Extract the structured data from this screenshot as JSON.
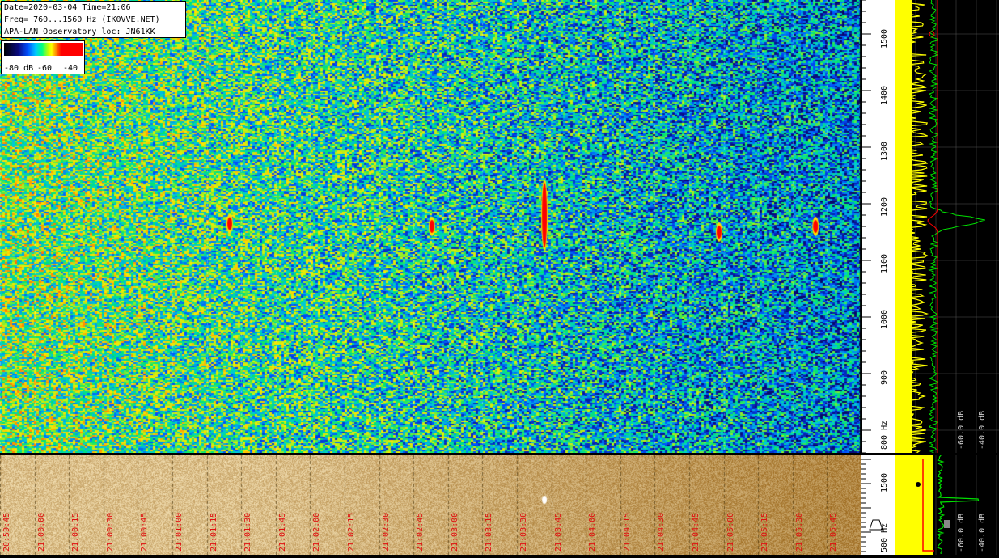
{
  "header": {
    "line1": "Date=2020-03-04 Time=21:06",
    "line2": "Freq= 760...1560 Hz (IK0VVE.NET)",
    "line3": "APA-LAN Observatory loc: JN61KK"
  },
  "colorbar": {
    "labels": [
      "-80 dB",
      "-60",
      "-40"
    ],
    "colors": [
      "#000000",
      "#0a0a80",
      "#0050ff",
      "#00c8ff",
      "#00ff80",
      "#ffff00",
      "#ff0000"
    ]
  },
  "freq_axis": {
    "ticks": [
      "800 Hz",
      "900",
      "1000",
      "1100",
      "1200",
      "1300",
      "1400",
      "1500"
    ],
    "bottom_ticks": [
      "500 Hz",
      "1500"
    ]
  },
  "profile": {
    "db_labels": [
      "-60.0 dB",
      "-40.0 dB"
    ],
    "bottom_db_labels": [
      "-60.0 dB",
      "-40.0 dB"
    ]
  },
  "time_axis": {
    "labels": [
      "20:59:45",
      "21:00:00",
      "21:00:15",
      "21:00:30",
      "21:00:45",
      "21:01:00",
      "21:01:15",
      "21:01:30",
      "21:01:45",
      "21:02:00",
      "21:02:15",
      "21:02:30",
      "21:02:45",
      "21:03:00",
      "21:03:15",
      "21:03:30",
      "21:03:45",
      "21:04:00",
      "21:04:15",
      "21:04:30",
      "21:04:45",
      "21:05:00",
      "21:05:15",
      "21:05:30",
      "21:05:45"
    ]
  },
  "chart_data": {
    "type": "heatmap",
    "description_of_axes": "x = time, y = frequency (Hz)",
    "xlim": [
      "20:59:45",
      "21:06:00"
    ],
    "ylim": [
      760,
      1560
    ],
    "color_scale_db": [
      -80,
      -40
    ],
    "meteor_echoes": [
      {
        "time": "21:01:25",
        "freq_hz": 1165,
        "strength_db": -40
      },
      {
        "time": "21:02:53",
        "freq_hz": 1160,
        "strength_db": -42
      },
      {
        "time": "21:03:42",
        "freq_hz": 1180,
        "strength_db": -38
      },
      {
        "time": "21:04:58",
        "freq_hz": 1150,
        "strength_db": -41
      },
      {
        "time": "21:05:40",
        "freq_hz": 1160,
        "strength_db": -45
      }
    ],
    "colors": {
      "profile_avg": "#ffff00",
      "profile_peak": "#00e000",
      "marker": "#ff0000"
    }
  }
}
